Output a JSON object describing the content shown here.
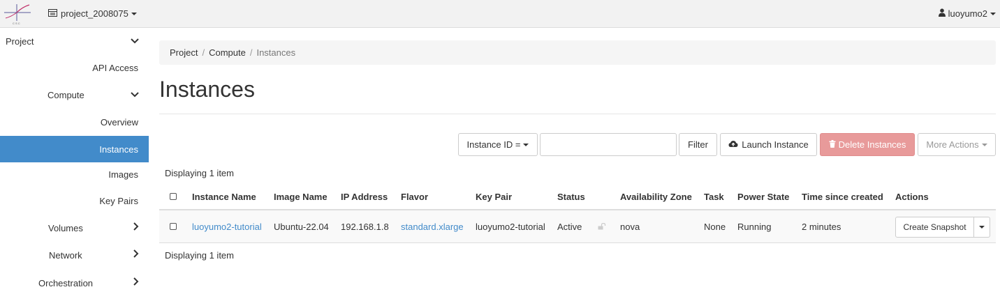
{
  "header": {
    "project_name": "project_2008075",
    "user_name": "luoyumo2"
  },
  "sidebar": {
    "project_label": "Project",
    "api_access": "API Access",
    "compute_label": "Compute",
    "overview": "Overview",
    "instances": "Instances",
    "images": "Images",
    "key_pairs": "Key Pairs",
    "volumes": "Volumes",
    "network": "Network",
    "orchestration": "Orchestration"
  },
  "breadcrumb": [
    "Project",
    "Compute",
    "Instances"
  ],
  "page_title": "Instances",
  "toolbar": {
    "filter_field": "Instance ID =",
    "filter_input_value": "",
    "filter_button": "Filter",
    "launch_button": "Launch Instance",
    "delete_button": "Delete Instances",
    "more_button": "More Actions"
  },
  "display_count": "Displaying 1 item",
  "table": {
    "columns": [
      "Instance Name",
      "Image Name",
      "IP Address",
      "Flavor",
      "Key Pair",
      "Status",
      "Availability Zone",
      "Task",
      "Power State",
      "Time since created",
      "Actions"
    ],
    "rows": [
      {
        "instance_name": "luoyumo2-tutorial",
        "image_name": "Ubuntu-22.04",
        "ip_address": "192.168.1.8",
        "flavor": "standard.xlarge",
        "key_pair": "luoyumo2-tutorial",
        "status": "Active",
        "availability_zone": "nova",
        "task": "None",
        "power_state": "Running",
        "time_since_created": "2 minutes",
        "action": "Create Snapshot"
      }
    ]
  },
  "colors": {
    "accent": "#428bca",
    "danger_disabled": "#e89a9a"
  }
}
